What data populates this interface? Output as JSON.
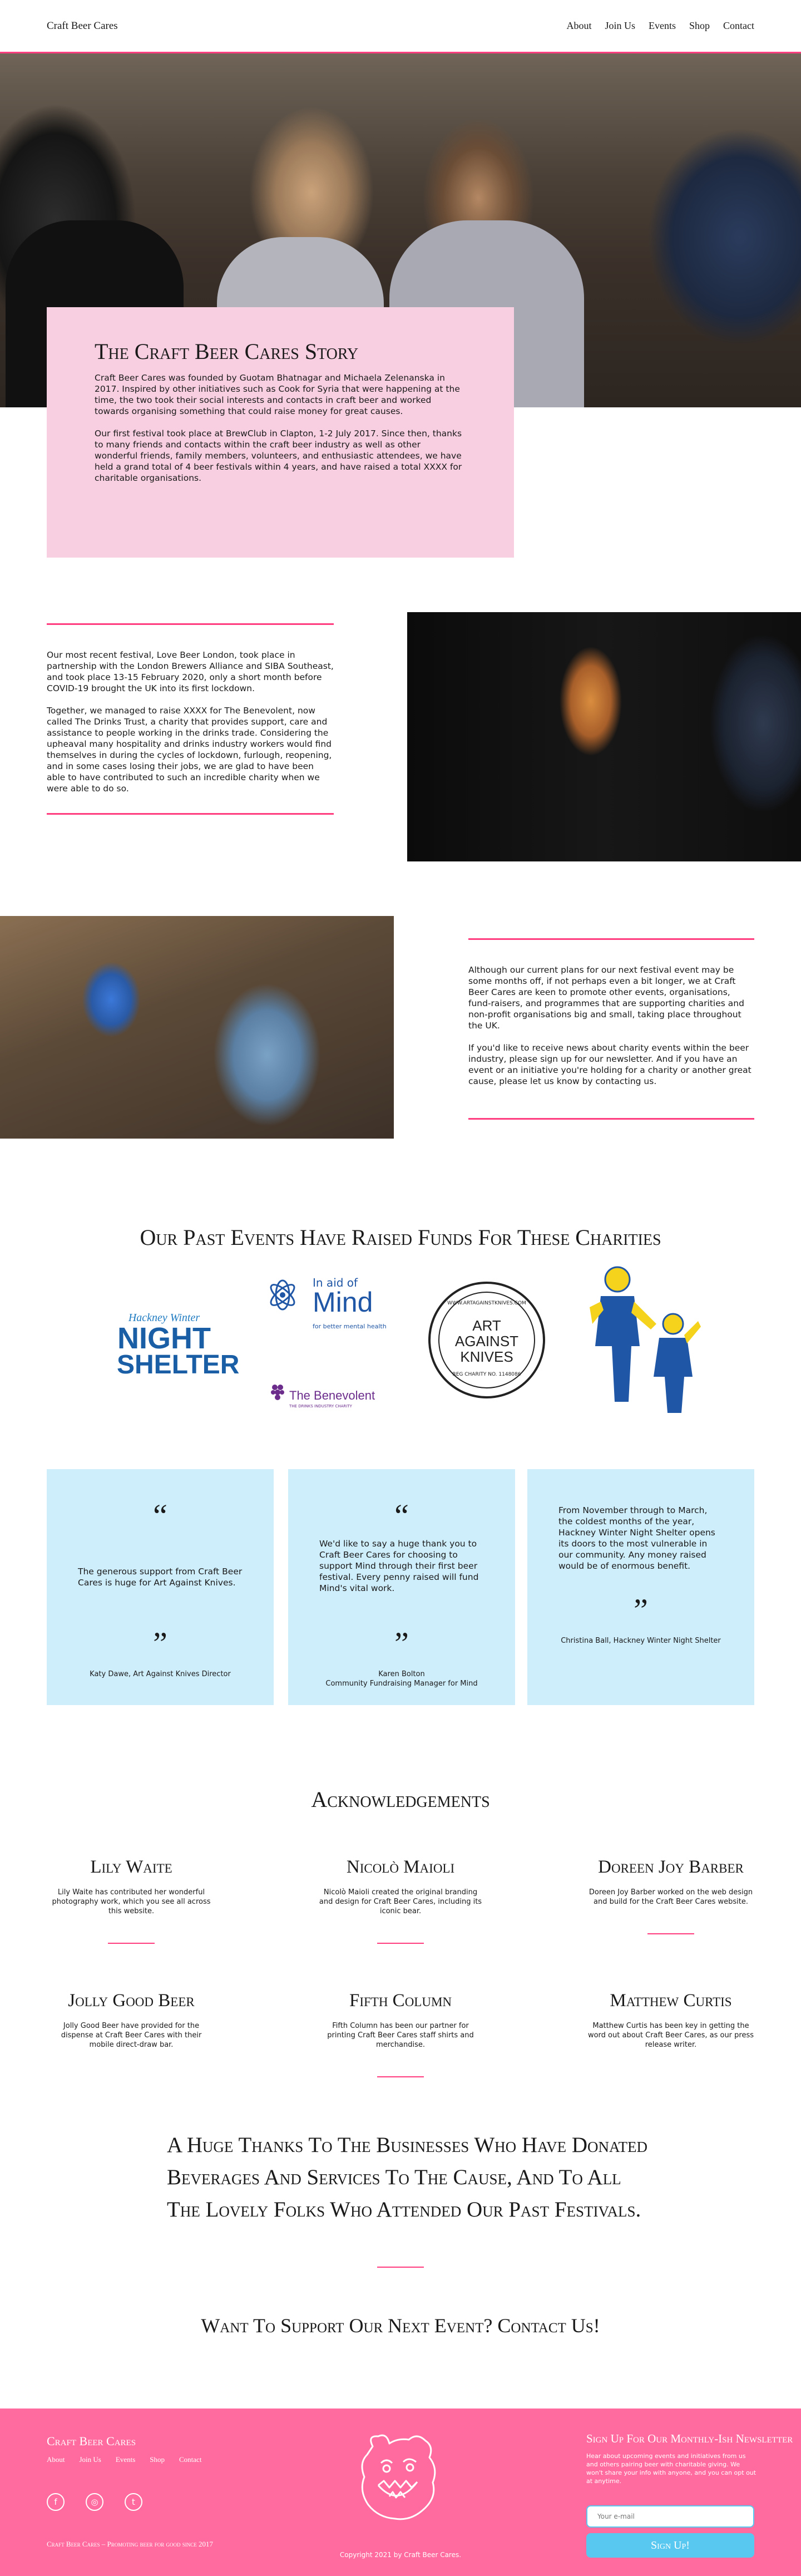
{
  "header": {
    "brand": "Craft Beer Cares",
    "nav": [
      "About",
      "Join Us",
      "Events",
      "Shop",
      "Contact"
    ]
  },
  "story": {
    "title": "The Craft Beer Cares Story",
    "p1": "Craft Beer Cares was founded by Guotam Bhatnagar and Michaela Zelenanska in 2017. Inspired by other initiatives such as Cook for Syria that were happening at the time, the two took their social interests and contacts in craft beer and worked towards organising something that could raise money for great causes.",
    "p2": "Our first festival took place at BrewClub in Clapton, 1-2 July 2017. Since then, thanks to many friends and contacts within the craft beer industry as well as other wonderful friends, family members, volunteers, and enthusiastic attendees, we have held a grand total of 4 beer festivals within 4 years, and have raised a total XXXX for charitable organisations."
  },
  "section2": {
    "p1": "Our most recent festival, Love Beer London, took place in partnership with the London Brewers Alliance and SIBA Southeast, and took place 13-15 February 2020, only a short month before COVID-19 brought the UK into its first lockdown.",
    "p2": "Together, we managed to raise XXXX for The Benevolent, now called The Drinks Trust, a charity that provides support, care and assistance to people working in the drinks trade. Considering the upheaval many hospitality and drinks industry workers would find themselves in during the cycles of lockdown, furlough, reopening, and in some cases losing their jobs, we are glad to have been able to have contributed to such an incredible charity when we were able to do so."
  },
  "section3": {
    "p1": "Although our current plans for our next festival event may be some months off, if not perhaps even a bit longer, we at Craft Beer Cares are keen to promote other events, organisations, fund-raisers, and programmes that are supporting charities and non-profit organisations big and small, taking place throughout the UK.",
    "p2": "If you'd like to receive news about charity events within the beer industry, please sign up for our newsletter. And if you have an event or an initiative you're holding for a charity or another great cause, please let us know by contacting us."
  },
  "charities": {
    "title": "Our Past Events Have Raised Funds For These Charities",
    "hackney_line1": "Hackney Winter",
    "hackney_line2": "NIGHT",
    "hackney_line3": "SHELTER",
    "mind_line1": "In aid of",
    "mind_word": "Mind",
    "mind_tag": "for better mental health",
    "benevolent": "The Benevolent",
    "benevolent_tag": "THE DRINKS INDUSTRY CHARITY",
    "aak_ring_top": "WWW.ARTAGAINSTKNIVES.COM",
    "aak_ring_bottom": "REG CHARITY NO. 1148086",
    "aak_line1": "ART",
    "aak_line2": "AGAINST",
    "aak_line3": "KNIVES"
  },
  "quotes": [
    {
      "mark_open": "“",
      "text": "The generous support from Craft Beer Cares is huge for Art Against Knives.",
      "mark_close": "”",
      "author1": "Katy Dawe, Art Against Knives Director",
      "author2": ""
    },
    {
      "mark_open": "“",
      "text": "We'd like to say a huge thank you to Craft Beer Cares for choosing to support Mind through their first beer festival. Every penny raised will fund Mind's vital work.",
      "mark_close": "”",
      "author1": "Karen Bolton",
      "author2": "Community Fundraising Manager for Mind"
    },
    {
      "mark_open": "“",
      "text": "From November through to March, the coldest months of the year, Hackney Winter Night Shelter opens its doors to the most vulnerable in our community. Any money raised would be of enormous benefit.",
      "mark_close": "”",
      "author1": "Christina Ball, Hackney Winter Night Shelter",
      "author2": ""
    }
  ],
  "acknowledgements": {
    "title": "Acknowledgements",
    "items": [
      {
        "name": "Lily Waite",
        "text": "Lily Waite has contributed her wonderful photography work, which you see all across this website."
      },
      {
        "name": "Nicolò Maioli",
        "text": "Nicolò Maioli created the original branding and design for Craft Beer Cares, including its iconic bear."
      },
      {
        "name": "Doreen Joy Barber",
        "text": "Doreen Joy Barber worked on the web design and build for the Craft Beer Cares website."
      },
      {
        "name": "Jolly Good Beer",
        "text": "Jolly Good Beer have provided for the dispense at Craft Beer Cares with their mobile direct-draw bar."
      },
      {
        "name": "Fifth Column",
        "text": "Fifth Column has been our partner for printing Craft Beer Cares staff shirts and merchandise."
      },
      {
        "name": "Matthew Curtis",
        "text": "Matthew Curtis has been key in getting the word out about Craft Beer Cares, as our press release writer."
      }
    ]
  },
  "thanks": "A Huge Thanks To The Businesses Who Have Donated Beverages And Services To The Cause, And To All The Lovely Folks Who Attended Our Past Festivals.",
  "support": "Want To Support Our Next Event? Contact Us!",
  "footer": {
    "brand": "Craft Beer Cares",
    "nav": [
      "About",
      "Join Us",
      "Events",
      "Shop",
      "Contact"
    ],
    "social": [
      "f",
      "◎",
      "t"
    ],
    "tagline": "Craft Beer Cares – Promoting beer for good since 2017",
    "copyright": "Copyright 2021 by Craft Beer Cares.",
    "signup_title": "Sign Up For Our Monthly-Ish Newsletter",
    "signup_desc": "Hear about upcoming events and initiatives from us and others pairing beer with charitable giving. We won't share your info with anyone, and you can opt out at anytime.",
    "email_placeholder": "Your e-mail",
    "signup_button": "Sign Up!"
  },
  "colors": {
    "accent": "#ff3d7f",
    "story_bg": "#f8cfe0",
    "quote_bg": "#cfeefc",
    "footer_bg": "#ff6b9e",
    "button": "#59c8f0"
  }
}
